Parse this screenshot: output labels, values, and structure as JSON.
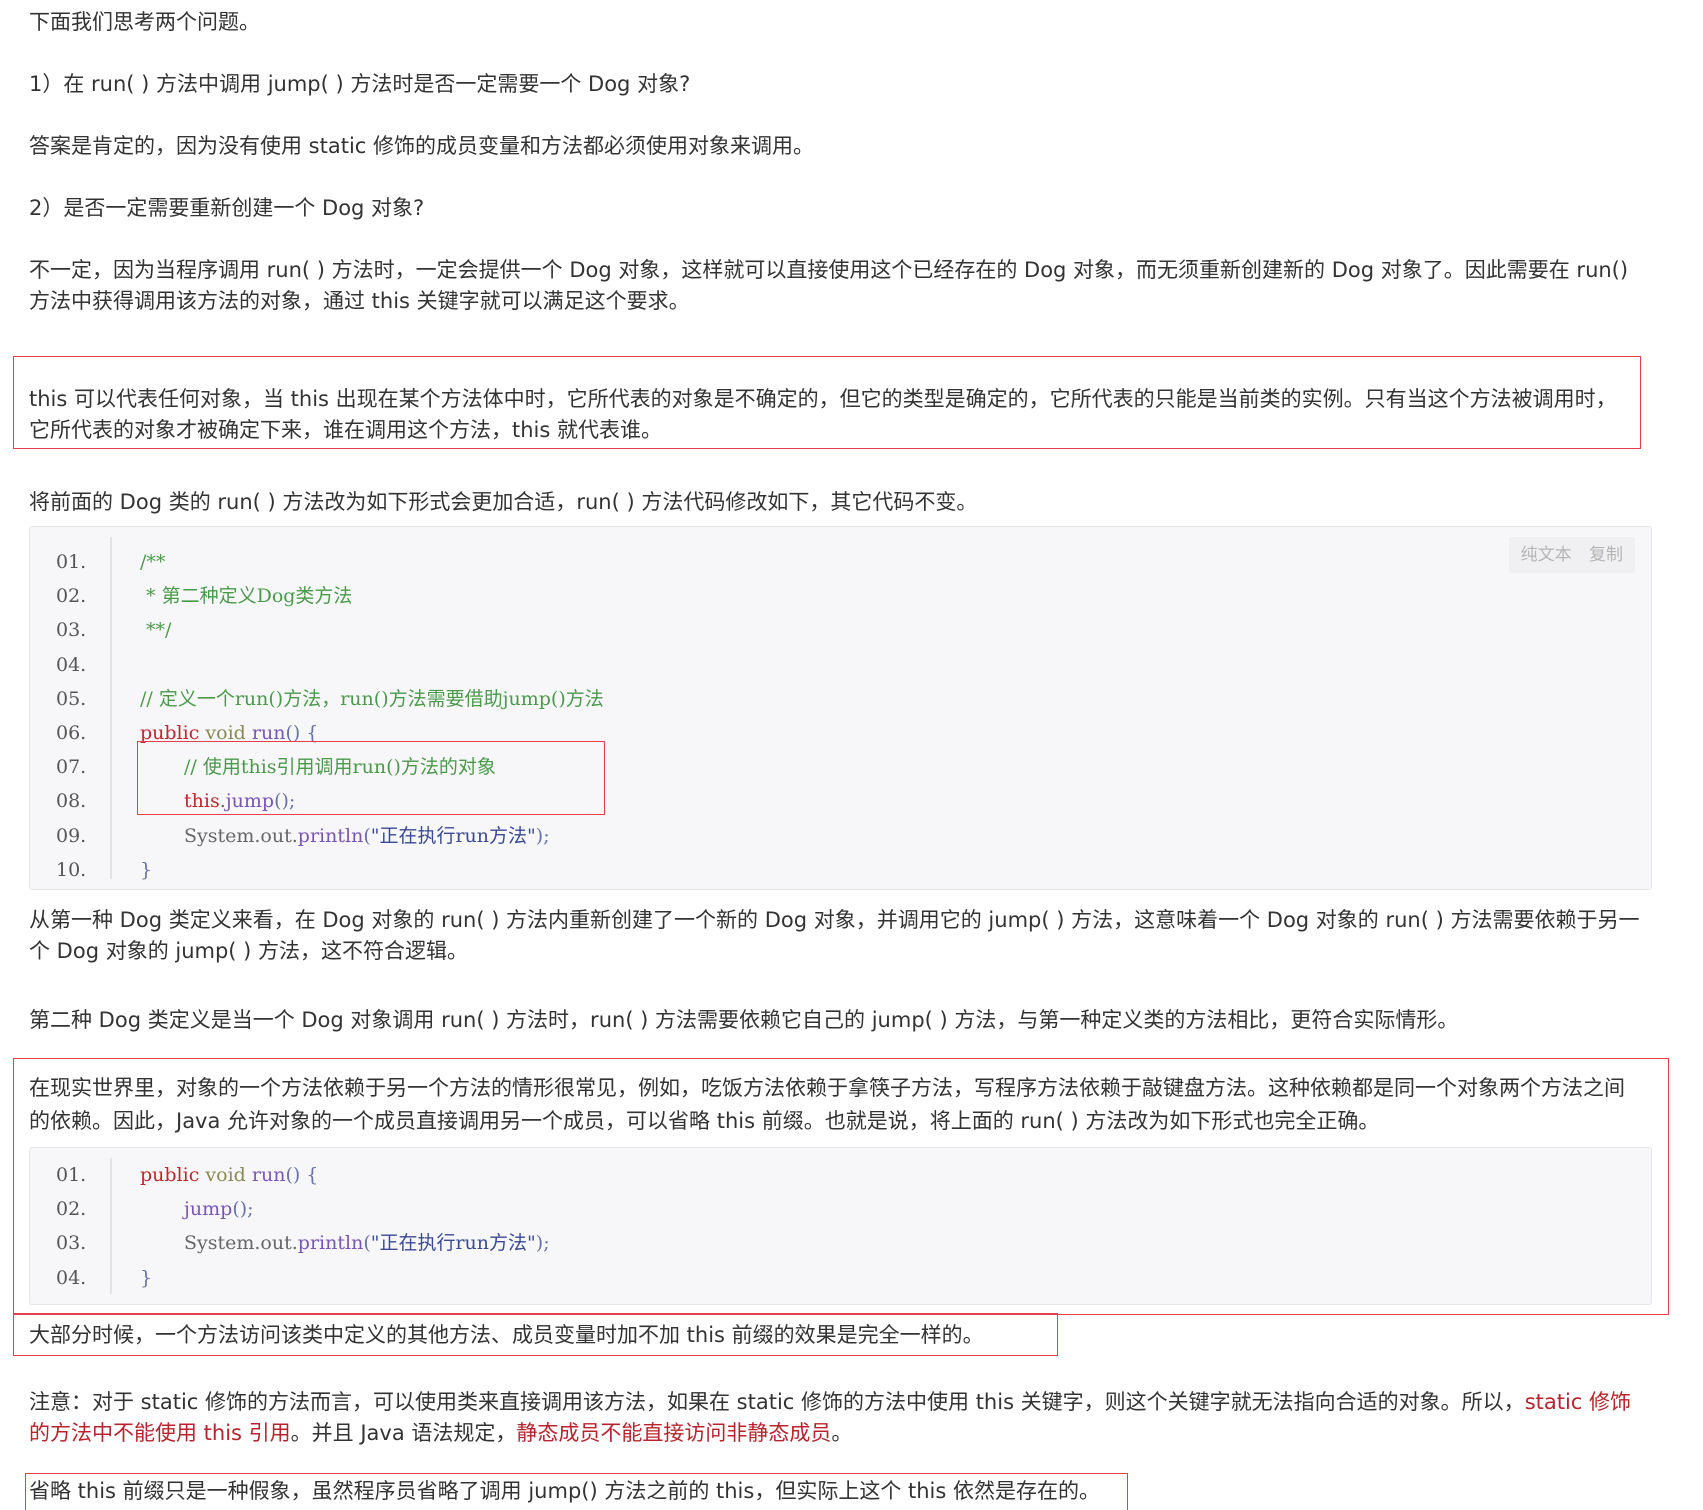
{
  "paragraphs": {
    "intro": "下面我们思考两个问题。",
    "q1": "1）在 run( ) 方法中调用 jump( ) 方法时是否一定需要一个 Dog 对象?",
    "a1": "答案是肯定的，因为没有使用 static 修饰的成员变量和方法都必须使用对象来调用。",
    "q2": "2）是否一定需要重新创建一个 Dog 对象?",
    "a2_line1": "不一定，因为当程序调用 run( ) 方法时，一定会提供一个 Dog 对象，这样就可以直接使用这个已经存在的 Dog 对象，而无须重新创建新的 Dog 对象了。因此需要在 run()",
    "a2_line2": "方法中获得调用该方法的对象，通过 this 关键字就可以满足这个要求。",
    "this_line1": "this 可以代表任何对象，当 this 出现在某个方法体中时，它所代表的对象是不确定的，但它的类型是确定的，它所代表的只能是当前类的实例。只有当这个方法被调用时，",
    "this_line2": "它所代表的对象才被确定下来，谁在调用这个方法，this 就代表谁。",
    "change": "将前面的 Dog 类的 run( ) 方法改为如下形式会更加合适，run( ) 方法代码修改如下，其它代码不变。",
    "first_line1": "从第一种 Dog 类定义来看，在 Dog 对象的 run( ) 方法内重新创建了一个新的 Dog 对象，并调用它的 jump( ) 方法，这意味着一个 Dog 对象的 run( ) 方法需要依赖于另一",
    "first_line2": "个 Dog 对象的 jump( ) 方法，这不符合逻辑。",
    "second": "第二种 Dog 类定义是当一个 Dog 对象调用 run( ) 方法时，run( ) 方法需要依赖它自己的 jump( ) 方法，与第一种定义类的方法相比，更符合实际情形。",
    "real_line1": "在现实世界里，对象的一个方法依赖于另一个方法的情形很常见，例如，吃饭方法依赖于拿筷子方法，写程序方法依赖于敲键盘方法。这种依赖都是同一个对象两个方法之间",
    "real_line2": "的依赖。因此，Java 允许对象的一个成员直接调用另一个成员，可以省略 this 前缀。也就是说，将上面的 run( ) 方法改为如下形式也完全正确。",
    "most": "大部分时候，一个方法访问该类中定义的其他方法、成员变量时加不加 this 前缀的效果是完全一样的。",
    "note_line1_a": "注意：对于 static 修饰的方法而言，可以使用类来直接调用该方法，如果在 static 修饰的方法中使用 this 关键字，则这个关键字就无法指向合适的对象。所以，",
    "note_line1_red": "static 修饰",
    "note_line2_red1": "的方法中不能使用 this 引用",
    "note_line2_mid": "。并且 Java 语法规定，",
    "note_line2_red2": "静态成员不能直接访问非静态成员",
    "note_line2_end": "。",
    "omit": "省略 this 前缀只是一种假象，虽然程序员省略了调用 jump() 方法之前的 this，但实际上这个 this 依然是存在的。"
  },
  "code1": {
    "toolbar": {
      "plain": "纯文本",
      "copy": "复制"
    },
    "lines": [
      {
        "num": "01.",
        "indent": "",
        "tokens": [
          {
            "t": "/**",
            "c": "com"
          }
        ]
      },
      {
        "num": "02.",
        "indent": "",
        "tokens": [
          {
            "t": " * 第二种定义Dog类方法",
            "c": "com"
          }
        ]
      },
      {
        "num": "03.",
        "indent": "",
        "tokens": [
          {
            "t": " **/",
            "c": "com"
          }
        ]
      },
      {
        "num": "04.",
        "indent": "",
        "tokens": []
      },
      {
        "num": "05.",
        "indent": "",
        "tokens": [
          {
            "t": "// 定义一个run()方法，run()方法需要借助jump()方法",
            "c": "com"
          }
        ]
      },
      {
        "num": "06.",
        "indent": "",
        "tokens": [
          {
            "t": "public",
            "c": "kw"
          },
          {
            "t": " ",
            "c": "pl"
          },
          {
            "t": "void",
            "c": "type"
          },
          {
            "t": " ",
            "c": "pl"
          },
          {
            "t": "run",
            "c": "fn"
          },
          {
            "t": "() {",
            "c": "punc"
          }
        ]
      },
      {
        "num": "07.",
        "indent": "    ",
        "tokens": [
          {
            "t": "// 使用this引用调用run()方法的对象",
            "c": "com"
          }
        ]
      },
      {
        "num": "08.",
        "indent": "    ",
        "tokens": [
          {
            "t": "this",
            "c": "kw"
          },
          {
            "t": ".",
            "c": "pl"
          },
          {
            "t": "jump",
            "c": "fn"
          },
          {
            "t": "();",
            "c": "punc"
          }
        ]
      },
      {
        "num": "09.",
        "indent": "    ",
        "tokens": [
          {
            "t": "System.out.",
            "c": "pl"
          },
          {
            "t": "println",
            "c": "fn"
          },
          {
            "t": "(",
            "c": "punc"
          },
          {
            "t": "\"正在执行run方法\"",
            "c": "str"
          },
          {
            "t": ");",
            "c": "punc"
          }
        ]
      },
      {
        "num": "10.",
        "indent": "",
        "tokens": [
          {
            "t": "}",
            "c": "punc"
          }
        ]
      }
    ]
  },
  "code2": {
    "lines": [
      {
        "num": "01.",
        "indent": "",
        "tokens": [
          {
            "t": "public",
            "c": "kw"
          },
          {
            "t": " ",
            "c": "pl"
          },
          {
            "t": "void",
            "c": "type"
          },
          {
            "t": " ",
            "c": "pl"
          },
          {
            "t": "run",
            "c": "fn"
          },
          {
            "t": "() {",
            "c": "punc"
          }
        ]
      },
      {
        "num": "02.",
        "indent": "    ",
        "tokens": [
          {
            "t": "jump",
            "c": "fn"
          },
          {
            "t": "();",
            "c": "punc"
          }
        ]
      },
      {
        "num": "03.",
        "indent": "    ",
        "tokens": [
          {
            "t": "System.out.",
            "c": "pl"
          },
          {
            "t": "println",
            "c": "fn"
          },
          {
            "t": "(",
            "c": "punc"
          },
          {
            "t": "\"正在执行run方法\"",
            "c": "str"
          },
          {
            "t": ");",
            "c": "punc"
          }
        ]
      },
      {
        "num": "04.",
        "indent": "",
        "tokens": [
          {
            "t": "}",
            "c": "punc"
          }
        ]
      }
    ]
  },
  "colors": {
    "highlight_box": "#e3404a",
    "emphasis_text": "#b9242c",
    "code_bg": "#f7f7f9",
    "comment": "#4a9a4a",
    "keyword": "#c2262a",
    "function": "#7a55b8"
  }
}
